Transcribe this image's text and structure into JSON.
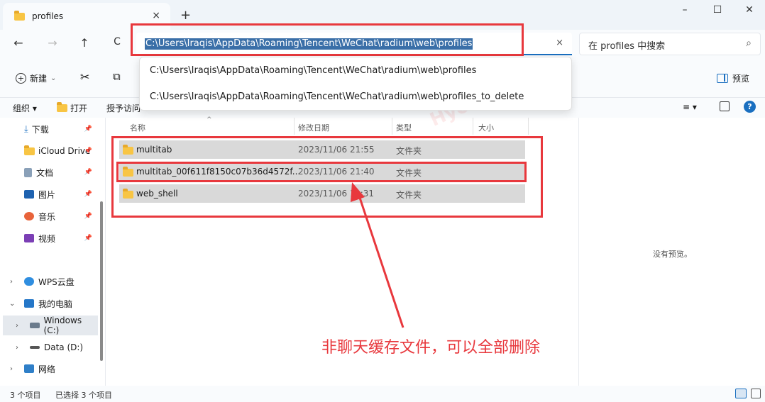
{
  "window": {
    "tab_title": "profiles",
    "tab_close": "×",
    "new_tab": "+",
    "minimize": "–",
    "maximize": "☐",
    "close": "✕"
  },
  "nav": {
    "back": "←",
    "forward": "→",
    "up": "↑",
    "refresh": "C",
    "address": "C:\\Users\\Iraqis\\AppData\\Roaming\\Tencent\\WeChat\\radium\\web\\profiles",
    "clear": "×",
    "search_placeholder": "在 profiles 中搜索",
    "search_icon": "⌕"
  },
  "dropdown": {
    "items": [
      "C:\\Users\\Iraqis\\AppData\\Roaming\\Tencent\\WeChat\\radium\\web\\profiles",
      "C:\\Users\\Iraqis\\AppData\\Roaming\\Tencent\\WeChat\\radium\\web\\profiles_to_delete"
    ]
  },
  "commands": {
    "new_label": "新建",
    "new_chevron": "⌄",
    "cut_icon": "✂",
    "copy_icon": "⧉",
    "preview_label": "预览"
  },
  "toolbar2": {
    "organize": "组织 ▾",
    "open": "打开",
    "share": "授予访问",
    "view_menu": "≡ ▾",
    "help": "?"
  },
  "sidebar": {
    "items": [
      {
        "label": "下载",
        "pinned": true
      },
      {
        "label": "iCloud Drive",
        "pinned": true
      },
      {
        "label": "文档",
        "pinned": true
      },
      {
        "label": "图片",
        "pinned": true
      },
      {
        "label": "音乐",
        "pinned": true
      },
      {
        "label": "视频",
        "pinned": true
      },
      {
        "label": "WPS云盘",
        "pinned": false
      },
      {
        "label": "我的电脑",
        "pinned": false
      },
      {
        "label": "Windows (C:)",
        "pinned": false
      },
      {
        "label": "Data (D:)",
        "pinned": false
      },
      {
        "label": "网络",
        "pinned": false
      }
    ],
    "pin_glyph": "📌"
  },
  "columns": [
    "名称",
    "修改日期",
    "类型",
    "大小"
  ],
  "files": [
    {
      "name": "multitab",
      "modified": "2023/11/06 21:55",
      "type": "文件夹"
    },
    {
      "name": "multitab_00f611f8150c07b36d4572f...",
      "modified": "2023/11/06 21:40",
      "type": "文件夹"
    },
    {
      "name": "web_shell",
      "modified": "2023/11/06 1x:31",
      "type": "文件夹"
    }
  ],
  "preview_pane": {
    "empty_text": "没有预览。"
  },
  "status": {
    "count": "3 个项目",
    "selected": "已选择 3 个项目"
  },
  "annotation": {
    "text": "非聊天缓存文件，可以全部删除",
    "color": "#e8383d"
  },
  "watermark": {
    "text": "Hyoase.com"
  }
}
